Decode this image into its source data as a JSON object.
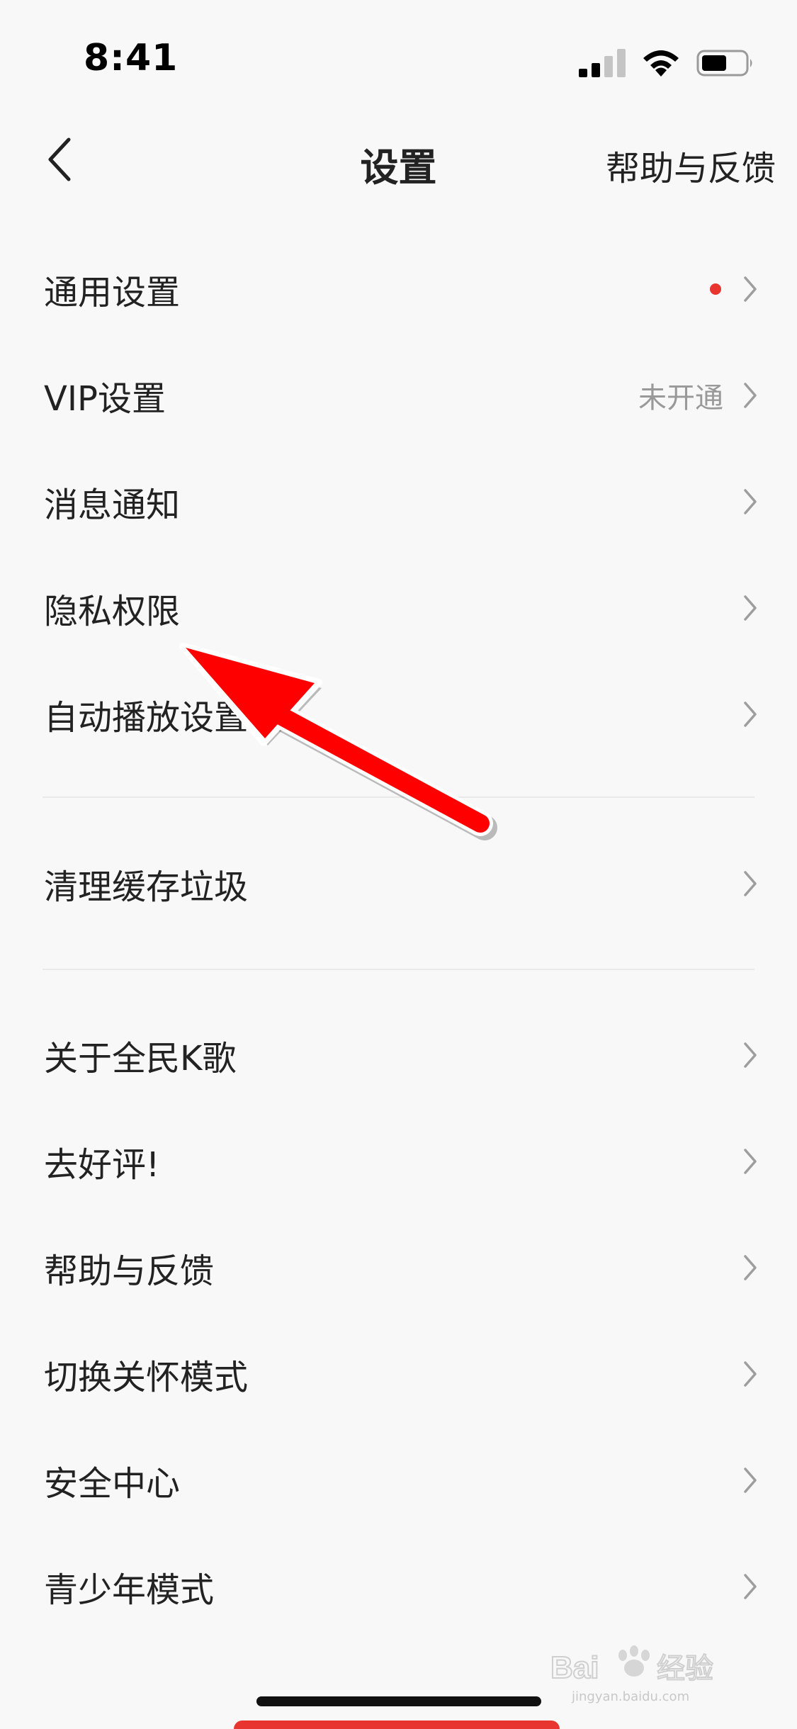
{
  "status_bar": {
    "time": "8:41"
  },
  "nav": {
    "title": "设置",
    "help_label": "帮助与反馈"
  },
  "rows": [
    {
      "label": "通用设置",
      "has_dot": true,
      "value": ""
    },
    {
      "label": "VIP设置",
      "has_dot": false,
      "value": "未开通"
    },
    {
      "label": "消息通知",
      "has_dot": false,
      "value": ""
    },
    {
      "label": "隐私权限",
      "has_dot": false,
      "value": ""
    },
    {
      "label": "自动播放设置",
      "has_dot": false,
      "value": ""
    },
    {
      "label": "清理缓存垃圾",
      "has_dot": false,
      "value": ""
    },
    {
      "label": "关于全民K歌",
      "has_dot": false,
      "value": ""
    },
    {
      "label": "去好评!",
      "has_dot": false,
      "value": ""
    },
    {
      "label": "帮助与反馈",
      "has_dot": false,
      "value": ""
    },
    {
      "label": "切换关怀模式",
      "has_dot": false,
      "value": ""
    },
    {
      "label": "安全中心",
      "has_dot": false,
      "value": ""
    },
    {
      "label": "青少年模式",
      "has_dot": false,
      "value": ""
    }
  ],
  "colors": {
    "background": "#f8f8f8",
    "text": "#222222",
    "secondary_text": "#999999",
    "badge_dot": "#e8352f",
    "annotation_arrow": "#ff0000"
  },
  "icons": {
    "back": "chevron-left-icon",
    "row": "chevron-right-icon",
    "signal": "signal-icon",
    "wifi": "wifi-icon",
    "battery": "battery-icon"
  },
  "watermark": {
    "text_brand": "Bai",
    "text_suffix": "经验",
    "text_url": "jingyan.baidu.com"
  }
}
